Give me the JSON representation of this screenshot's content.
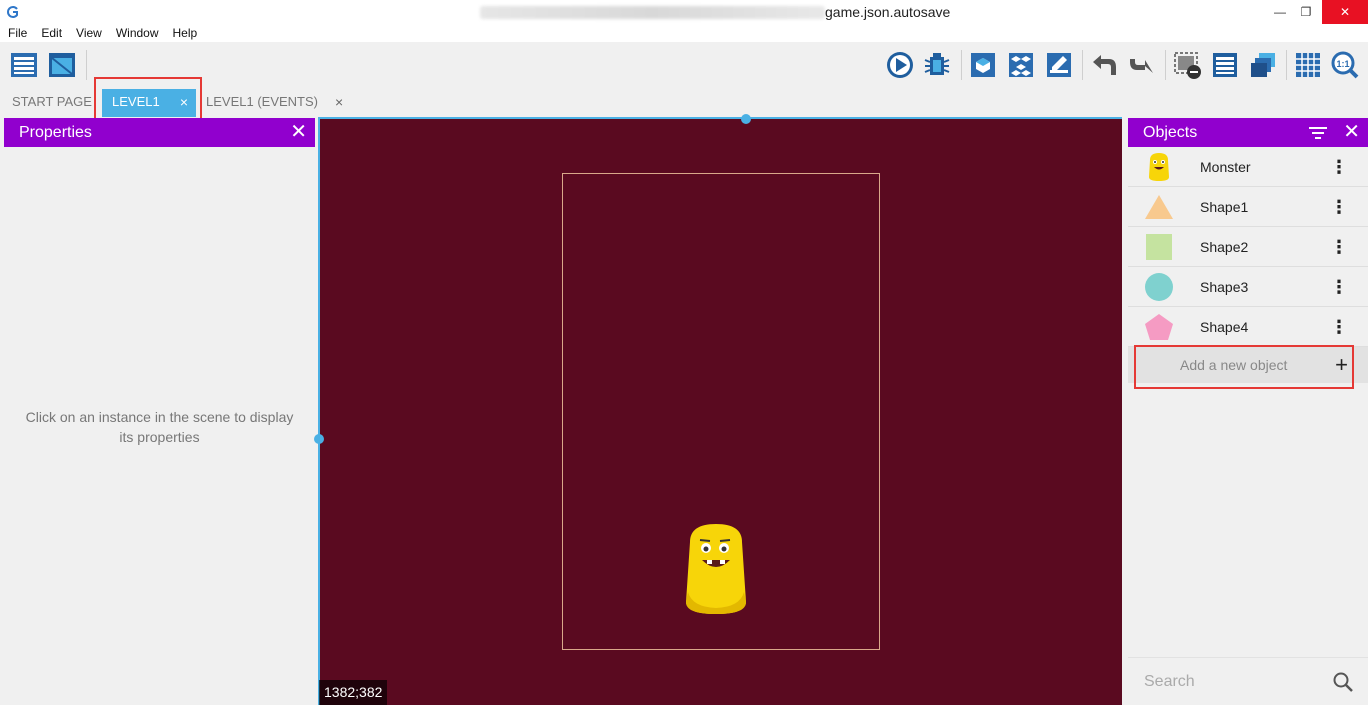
{
  "window": {
    "title_suffix": "game.json.autosave",
    "controls": {
      "minimize": "—",
      "restore": "❐",
      "close": "✕"
    }
  },
  "menu": {
    "items": [
      "File",
      "Edit",
      "View",
      "Window",
      "Help"
    ]
  },
  "toolbar": {
    "icons": [
      "project-manager-icon",
      "scene-editor-icon",
      "preview-icon",
      "debug-icon",
      "object-editor-icon",
      "object-groups-icon",
      "edit-properties-icon",
      "undo-icon",
      "redo-icon",
      "delete-instance-icon",
      "instances-list-icon",
      "layers-icon",
      "grid-icon",
      "zoom-reset-icon"
    ],
    "zoom_reset_label": "1:1"
  },
  "tabs": [
    {
      "label": "START PAGE",
      "active": false,
      "closable": false
    },
    {
      "label": "LEVEL1",
      "active": true,
      "closable": true,
      "close": "×"
    },
    {
      "label": "LEVEL1 (EVENTS)",
      "active": false,
      "closable": true,
      "close": "×"
    }
  ],
  "properties": {
    "title": "Properties",
    "close": "✕",
    "empty_message": "Click on an instance in the scene to display its properties"
  },
  "scene": {
    "background": "#5a0a20",
    "coordinates": "1382;382",
    "selection_color": "#4ab0e4"
  },
  "objects": {
    "title": "Objects",
    "close": "✕",
    "items": [
      {
        "name": "Monster",
        "thumb": "monster",
        "menu": "⋮"
      },
      {
        "name": "Shape1",
        "thumb": "triangle",
        "color": "#f8c98e",
        "menu": "⋮"
      },
      {
        "name": "Shape2",
        "thumb": "square",
        "color": "#c5e3a0",
        "menu": "⋮"
      },
      {
        "name": "Shape3",
        "thumb": "circle",
        "color": "#7fd1cf",
        "menu": "⋮"
      },
      {
        "name": "Shape4",
        "thumb": "pentagon",
        "color": "#f59bc3",
        "menu": "⋮"
      }
    ],
    "add_label": "Add a new object",
    "add_icon": "+",
    "search_placeholder": "Search"
  },
  "colors": {
    "panel_header": "#9100ce",
    "active_tab": "#4ab0e4",
    "highlight": "#e53935"
  }
}
